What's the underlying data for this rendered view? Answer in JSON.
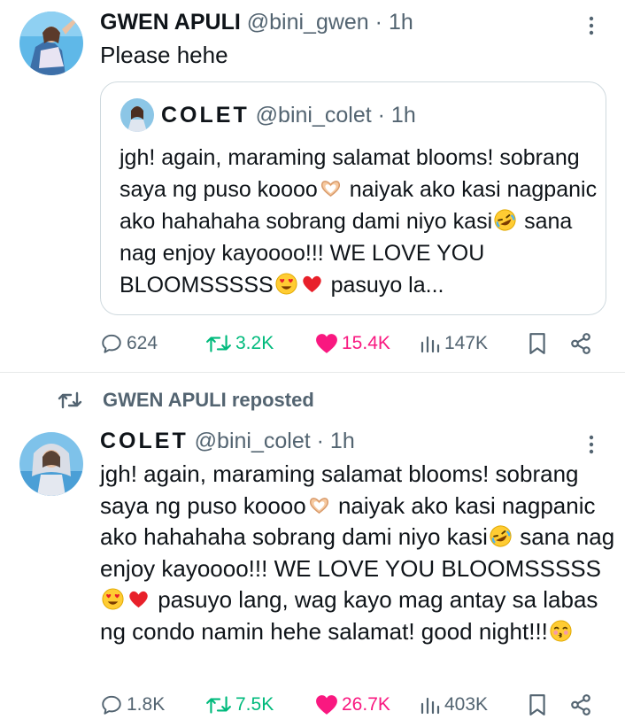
{
  "tweet1": {
    "author_name": "GWEN APULI",
    "handle": "@bini_gwen",
    "separator": "·",
    "time": "1h",
    "text": "Please hehe",
    "quoted": {
      "author_name": "COLET",
      "handle": "@bini_colet",
      "separator": "·",
      "time": "1h",
      "text_parts": [
        "jgh! again, maraming salamat blooms! sobrang saya ng puso koooo",
        " naiyak ako kasi nagpanic ako hahahaha sobrang dami niyo kasi",
        " sana nag enjoy kayoooo!!! WE LOVE YOU BLOOMSSSSS",
        " pasuyo la..."
      ]
    },
    "stats": {
      "replies": "624",
      "reposts": "3.2K",
      "likes": "15.4K",
      "views": "147K"
    }
  },
  "tweet2": {
    "reposted_by": "GWEN APULI reposted",
    "author_name": "COLET",
    "handle": "@bini_colet",
    "separator": "·",
    "time": "1h",
    "text_parts": [
      "jgh! again, maraming salamat blooms! sobrang saya ng puso koooo",
      " naiyak ako kasi nagpanic ako hahahaha sobrang dami niyo kasi",
      " sana nag enjoy kayoooo!!! WE LOVE YOU BLOOMSSSSS",
      " pasuyo lang, wag kayo mag antay sa labas ng condo namin hehe salamat! good night!!!"
    ],
    "stats": {
      "replies": "1.8K",
      "reposts": "7.5K",
      "likes": "26.7K",
      "views": "403K"
    }
  },
  "colors": {
    "text": "#0f1419",
    "secondary": "#536471",
    "repost": "#00ba7c",
    "like": "#f91880",
    "border": "#cfd9de"
  },
  "icons": [
    "more-icon",
    "reply-icon",
    "repost-icon",
    "heart-icon",
    "views-icon",
    "bookmark-icon",
    "share-icon",
    "heart-hands-emoji",
    "rofl-emoji",
    "heart-eyes-emoji",
    "red-heart-emoji",
    "kissing-emoji"
  ]
}
